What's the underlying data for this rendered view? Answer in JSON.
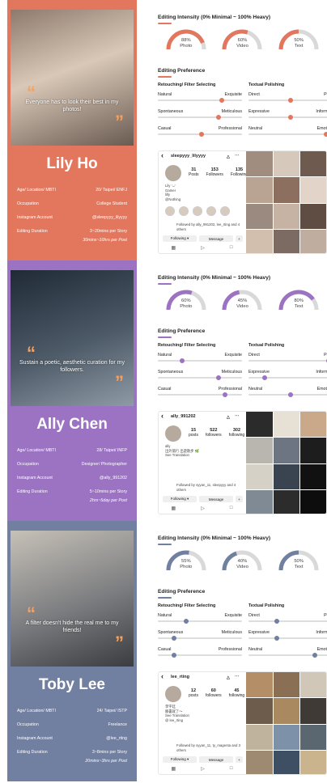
{
  "sections": [
    {
      "name": "Lily Ho",
      "quote": "Everyone has to look their best in my photos!",
      "bg": "#e2775e",
      "accent": "#e2775e",
      "info": [
        {
          "label": "Age/ Location/ MBTI",
          "value": "20/ Taipei/ ENFJ"
        },
        {
          "label": "Occupation",
          "value": "College Student"
        },
        {
          "label": "Instagram Account",
          "value": "@sleepyyy_lilyyyy"
        },
        {
          "label": "Editing Duration",
          "value": "3~20mins per Story"
        }
      ],
      "extra": "30mins~10hrs per Post",
      "intensity": {
        "title": "Editing Intensity (0% Minimal ~ 100% Heavy)",
        "gauges": [
          {
            "value": "88%",
            "label": "Photo",
            "pct": 0.88
          },
          {
            "value": "60%",
            "label": "Video",
            "pct": 0.6
          },
          {
            "value": "50%",
            "label": "Text",
            "pct": 0.5
          }
        ]
      },
      "preference_title": "Editing Preference",
      "col1_title": "Retouching/ Filter Selecting",
      "col2_title": "Textual Polishing",
      "sliders_left": [
        {
          "l": "Natural",
          "r": "Exquisite",
          "pos": 0.78
        },
        {
          "l": "Spontaneous",
          "r": "Meticulous",
          "pos": 0.73
        },
        {
          "l": "Casual",
          "r": "Professional",
          "pos": 0.52
        }
      ],
      "sliders_right": [
        {
          "l": "Direct",
          "r": "Poet",
          "pos": 0.5
        },
        {
          "l": "Expressive",
          "r": "Informati",
          "pos": 0.5
        },
        {
          "l": "Neutral",
          "r": "Emotion",
          "pos": 0.95
        }
      ],
      "profile": {
        "username": "sleepyyy_lilyyyy",
        "posts": "31",
        "posts_label": "Posts",
        "followers": "153",
        "followers_label": "Followers",
        "following": "135",
        "following_label": "Following",
        "bio": "Lily ᵔᴗᵔ\nGamer\nlilly\n@Nothing",
        "followed_by": "Followed by ally_991202, lee_rting and 4 others",
        "following_btn": "Following ▾",
        "message_btn": "Message"
      }
    },
    {
      "name": "Ally Chen",
      "quote": "Sustain a poetic, aesthetic curation for my followers.",
      "bg": "#9b73c2",
      "accent": "#9b73c2",
      "info": [
        {
          "label": "Age/ Location/ MBTI",
          "value": "28/ Taipei/ INFP"
        },
        {
          "label": "Occupation",
          "value": "Designer/ Photographer"
        },
        {
          "label": "Instagram Account",
          "value": "@ally_991202"
        },
        {
          "label": "Editing Duration",
          "value": "5~10mins per Story"
        }
      ],
      "extra": "2hrs~5day per Post",
      "intensity": {
        "title": "Editing Intensity (0% Minimal ~ 100% Heavy)",
        "gauges": [
          {
            "value": "60%",
            "label": "Photo",
            "pct": 0.6
          },
          {
            "value": "45%",
            "label": "Video",
            "pct": 0.45
          },
          {
            "value": "80%",
            "label": "Text",
            "pct": 0.8
          }
        ]
      },
      "preference_title": "Editing Preference",
      "col1_title": "Retouching/ Filter Selecting",
      "col2_title": "Textual Polishing",
      "sliders_left": [
        {
          "l": "Natural",
          "r": "Exquisite",
          "pos": 0.28
        },
        {
          "l": "Spontaneous",
          "r": "Meticulous",
          "pos": 0.73
        },
        {
          "l": "Casual",
          "r": "Professional",
          "pos": 0.82
        }
      ],
      "sliders_right": [
        {
          "l": "Direct",
          "r": "Poet",
          "pos": 0.98
        },
        {
          "l": "Expressive",
          "r": "Informati",
          "pos": 0.17
        },
        {
          "l": "Neutral",
          "r": "Emotion",
          "pos": 0.5
        }
      ],
      "profile": {
        "username": "ally_991202",
        "posts": "15",
        "posts_label": "posts",
        "followers": "522",
        "followers_label": "followers",
        "following": "302",
        "following_label": "following",
        "bio": "ally\n出外旅行 出遊散步 🌿\nSee Translation",
        "followed_by": "Followed by syyan_11, sleepyyy and 4 others",
        "following_btn": "Following ▾",
        "message_btn": "Message"
      }
    },
    {
      "name": "Toby Lee",
      "quote": "A filter doesn't hide the real me to my friends!",
      "bg": "#717fa0",
      "accent": "#717fa0",
      "info": [
        {
          "label": "Age/ Location/ MBTI",
          "value": "24/ Taipei/ ISTP"
        },
        {
          "label": "Occupation",
          "value": "Freelance"
        },
        {
          "label": "Instagram Account",
          "value": "@lee_rting"
        },
        {
          "label": "Editing Duration",
          "value": "3~8mins per Story"
        }
      ],
      "extra": "20mins~3hrs per Post",
      "intensity": {
        "title": "Editing Intensity (0% Minimal ~ 100% Heavy)",
        "gauges": [
          {
            "value": "55%",
            "label": "Photo",
            "pct": 0.55
          },
          {
            "value": "40%",
            "label": "Video",
            "pct": 0.4
          },
          {
            "value": "50%",
            "label": "Text",
            "pct": 0.5
          }
        ]
      },
      "preference_title": "Editing Preference",
      "col1_title": "Retouching/ Filter Selecting",
      "col2_title": "Textual Polishing",
      "sliders_left": [
        {
          "l": "Natural",
          "r": "Exquisite",
          "pos": 0.33
        },
        {
          "l": "Spontaneous",
          "r": "Meticulous",
          "pos": 0.17
        },
        {
          "l": "Casual",
          "r": "Professional",
          "pos": 0.17
        }
      ],
      "sliders_right": [
        {
          "l": "Direct",
          "r": "Poet",
          "pos": 0.33
        },
        {
          "l": "Expressive",
          "r": "Informati",
          "pos": 0.33
        },
        {
          "l": "Neutral",
          "r": "Emotion",
          "pos": 0.81
        }
      ],
      "profile": {
        "username": "lee_rting",
        "posts": "12",
        "posts_label": "posts",
        "followers": "60",
        "followers_label": "followers",
        "following": "45",
        "following_label": "following",
        "bio": "李宇廷\n臉書就了～\nSee Translation\n@ lee_rting",
        "followed_by": "Followed by syyan_11, ty_magenta and 3 others",
        "following_btn": "Following ▾",
        "message_btn": "Message"
      }
    }
  ]
}
